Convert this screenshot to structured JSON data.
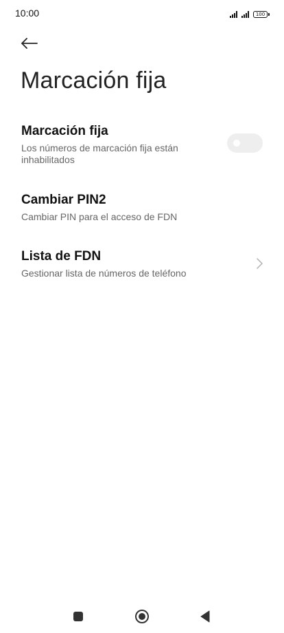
{
  "status_bar": {
    "time": "10:00",
    "battery": "100"
  },
  "page": {
    "title": "Marcación fija"
  },
  "settings": {
    "fixed_dialing": {
      "title": "Marcación fija",
      "summary": "Los números de marcación fija están inhabilitados",
      "enabled": false
    },
    "change_pin2": {
      "title": "Cambiar PIN2",
      "summary": "Cambiar PIN para el acceso de FDN"
    },
    "fdn_list": {
      "title": "Lista de FDN",
      "summary": "Gestionar lista de números de teléfono"
    }
  },
  "icons": {
    "back": "back-arrow-icon",
    "chevron": "chevron-right-icon",
    "nav_recents": "square-icon",
    "nav_home": "circle-home-icon",
    "nav_back": "triangle-back-icon"
  },
  "colors": {
    "background": "#ffffff",
    "toggle_off": "#eeeeee",
    "summary_text": "#666666"
  }
}
